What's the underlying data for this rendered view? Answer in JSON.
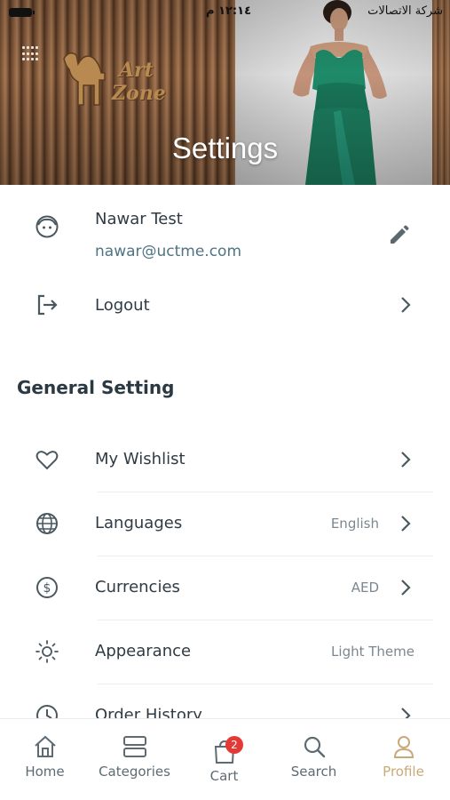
{
  "status_bar": {
    "time": "١٢:١٤ م",
    "carrier": "شركة الاتصالات"
  },
  "header": {
    "title": "Settings",
    "logo_text_1": "Art",
    "logo_text_2": "Zone",
    "logo_icon": "camel-logo-icon",
    "menu_icon": "grid-menu-icon"
  },
  "profile": {
    "name": "Nawar Test",
    "email": "nawar@uctme.com",
    "avatar_icon": "user-face-icon",
    "edit_icon": "pencil-icon"
  },
  "logout": {
    "label": "Logout",
    "icon": "logout-icon"
  },
  "general_setting": {
    "title": "General Setting",
    "items": [
      {
        "label": "My Wishlist",
        "value": "",
        "icon": "heart-icon"
      },
      {
        "label": "Languages",
        "value": "English",
        "icon": "globe-icon"
      },
      {
        "label": "Currencies",
        "value": "AED",
        "icon": "dollar-icon"
      },
      {
        "label": "Appearance",
        "value": "Light Theme",
        "icon": "sun-icon"
      },
      {
        "label": "Order History",
        "value": "",
        "icon": "clock-icon"
      }
    ]
  },
  "bottom_nav": {
    "items": [
      {
        "label": "Home",
        "icon": "home-icon"
      },
      {
        "label": "Categories",
        "icon": "categories-icon"
      },
      {
        "label": "Cart",
        "icon": "cart-icon",
        "badge": "2"
      },
      {
        "label": "Search",
        "icon": "search-icon"
      },
      {
        "label": "Profile",
        "icon": "profile-icon",
        "active": true
      }
    ]
  },
  "colors": {
    "accent": "#c8aa78",
    "text": "#2f3b44",
    "email": "#4f7483",
    "badge": "#e53935"
  }
}
